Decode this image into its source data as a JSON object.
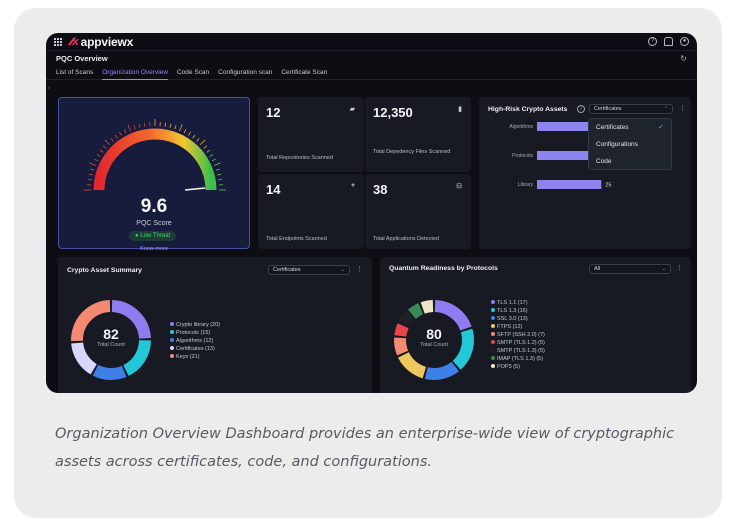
{
  "app": {
    "brand": "appviewx",
    "brand_mark": "⁄⁄⁄x",
    "page_title": "PQC Overview"
  },
  "tabs": [
    {
      "label": "List of Scans",
      "active": false
    },
    {
      "label": "Organization Overview",
      "active": true
    },
    {
      "label": "Code Scan",
      "active": false
    },
    {
      "label": "Configuration scan",
      "active": false
    },
    {
      "label": "Certificate Scan",
      "active": false
    }
  ],
  "pqc": {
    "score": "9.6",
    "score_label": "PQC Score",
    "threat": "Low Threat",
    "know_more": "Know more"
  },
  "stats": [
    {
      "value": "12",
      "label": "Total Repositories Scanned",
      "icon": "folder-icon"
    },
    {
      "value": "12,350",
      "label": "Total Depedency Files Scanned",
      "icon": "file-icon"
    },
    {
      "value": "14",
      "label": "Total Endpoints Scanned",
      "icon": "asterisk-icon"
    },
    {
      "value": "38",
      "label": "Total Applications Detected",
      "icon": "apps-icon"
    }
  ],
  "high_risk": {
    "title": "High-Risk Crypto Assets",
    "selected": "Certificates",
    "options": [
      "Certificates",
      "Configurations",
      "Code"
    ],
    "bars": [
      {
        "label": "Algorithms",
        "value": 28,
        "value_text": ""
      },
      {
        "label": "Protocols",
        "value": 27,
        "value_text": "27"
      },
      {
        "label": "Library",
        "value": 25,
        "value_text": "25"
      }
    ]
  },
  "crypto_summary": {
    "title": "Crypto Asset Summary",
    "selected": "Certificates",
    "total": "82",
    "total_label": "Total Count",
    "legend": [
      {
        "label": "Crypto library (20)",
        "value": 20,
        "color": "#8f7cf0"
      },
      {
        "label": "Protocols (15)",
        "value": 15,
        "color": "#22c8d8"
      },
      {
        "label": "Algorithms (12)",
        "value": 12,
        "color": "#3f7fe8"
      },
      {
        "label": "Certificates (13)",
        "value": 13,
        "color": "#d9d7ff"
      },
      {
        "label": "Keys (21)",
        "value": 21,
        "color": "#f58a73"
      }
    ]
  },
  "quantum": {
    "title": "Quantum Readiness by Protocols",
    "selected": "All",
    "total": "80",
    "total_label": "Total Count",
    "legend": [
      {
        "label": "TLS 1.1 (17)",
        "value": 17,
        "color": "#8f7cf0"
      },
      {
        "label": "TLS 1.3 (16)",
        "value": 16,
        "color": "#22c8d8"
      },
      {
        "label": "SSL 3.0 (13)",
        "value": 13,
        "color": "#3f7fe8"
      },
      {
        "label": "FTPS (12)",
        "value": 12,
        "color": "#f0c75e"
      },
      {
        "label": "SFTP (SSH 2.0) (7)",
        "value": 7,
        "color": "#f58a73"
      },
      {
        "label": "SMTP (TLS 1.2) (5)",
        "value": 5,
        "color": "#e8434e"
      },
      {
        "label": "SMTP (TLS 1.3) (5)",
        "value": 5,
        "color": "#1f1f25"
      },
      {
        "label": "IMAP (TLS 1.3) (5)",
        "value": 5,
        "color": "#3a8a57"
      },
      {
        "label": "POP3 (5)",
        "value": 5,
        "color": "#efe6c8"
      }
    ]
  },
  "caption": "Organization Overview Dashboard provides an enterprise-wide view of cryptographic assets across certificates, code, and configurations."
}
